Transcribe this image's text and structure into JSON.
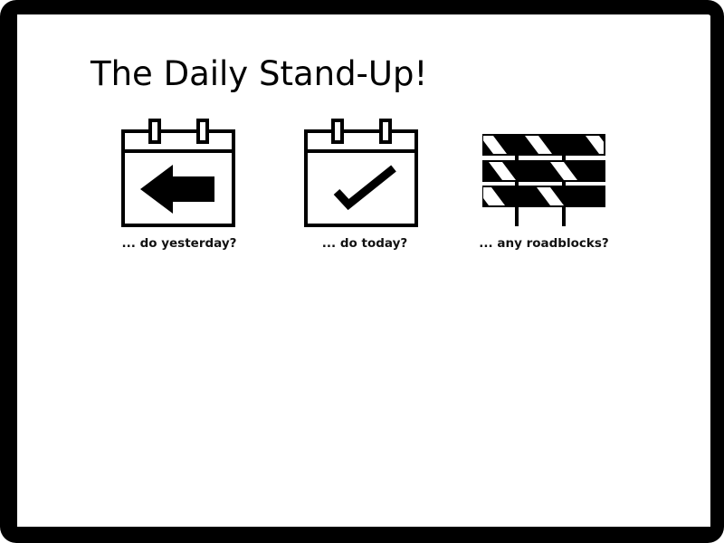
{
  "title": "The Daily Stand-Up!",
  "items": [
    {
      "icon": "calendar-arrow-left-icon",
      "caption": "... do yesterday?"
    },
    {
      "icon": "calendar-check-icon",
      "caption": "... do today?"
    },
    {
      "icon": "roadblock-barricade-icon",
      "caption": "... any roadblocks?"
    }
  ]
}
